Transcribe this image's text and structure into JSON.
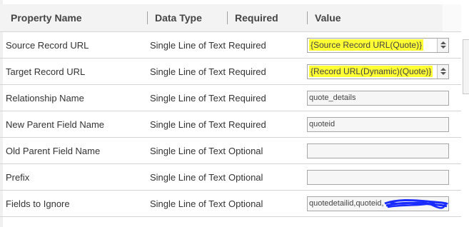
{
  "table": {
    "headers": {
      "name": "Property Name",
      "type": "Data Type",
      "required": "Required",
      "value": "Value"
    },
    "rows": [
      {
        "name": "Source Record URL",
        "type": "Single Line of Text",
        "required": "Required",
        "value": "{Source Record URL(Quote)}"
      },
      {
        "name": "Target Record URL",
        "type": "Single Line of Text",
        "required": "Required",
        "value": "{Record URL(Dynamic)(Quote)}"
      },
      {
        "name": "Relationship Name",
        "type": "Single Line of Text",
        "required": "Required",
        "value": "quote_details"
      },
      {
        "name": "New Parent Field Name",
        "type": "Single Line of Text",
        "required": "Required",
        "value": "quoteid"
      },
      {
        "name": "Old Parent Field Name",
        "type": "Single Line of Text",
        "required": "Optional",
        "value": ""
      },
      {
        "name": "Prefix",
        "type": "Single Line of Text",
        "required": "Optional",
        "value": ""
      },
      {
        "name": "Fields to Ignore",
        "type": "Single Line of Text",
        "required": "Optional",
        "value": "quotedetailid,quoteid,"
      }
    ]
  },
  "colors": {
    "highlight": "#ffff33",
    "redaction": "#1a2bff",
    "header_bg": "#f3f3f3"
  }
}
